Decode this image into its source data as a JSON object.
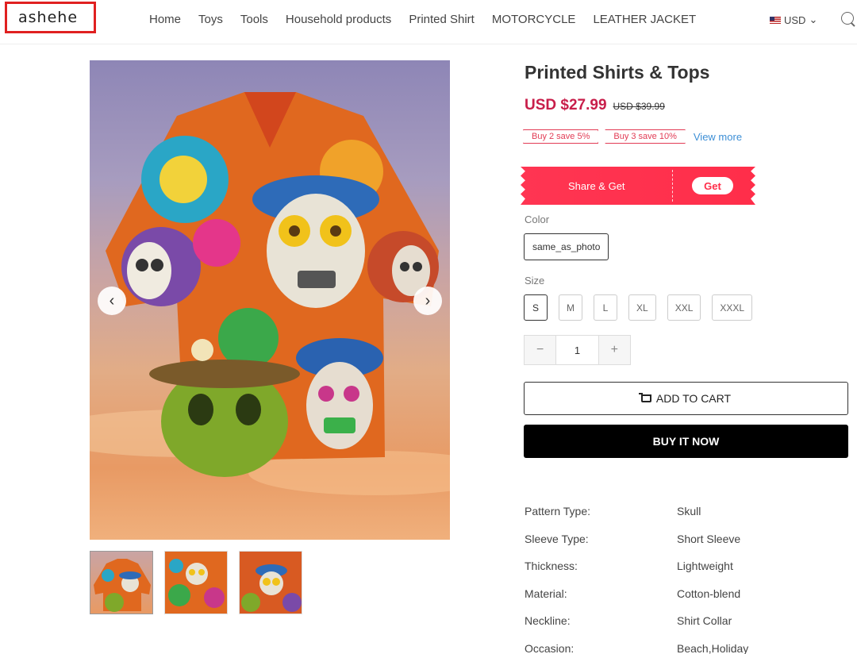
{
  "header": {
    "logo": "ashehe",
    "nav": [
      "Home",
      "Toys",
      "Tools",
      "Household products",
      "Printed Shirt",
      "MOTORCYCLE",
      "LEATHER JACKET"
    ],
    "currency": "USD"
  },
  "product": {
    "title": "Printed Shirts & Tops",
    "price_now": "USD $27.99",
    "price_was": "USD $39.99",
    "promos": [
      "Buy 2 save 5%",
      "Buy 3 save 10%"
    ],
    "view_more": "View more",
    "share_label": "Share & Get",
    "share_button": "Get",
    "color_label": "Color",
    "color_value": "same_as_photo",
    "size_label": "Size",
    "sizes": [
      "S",
      "M",
      "L",
      "XL",
      "XXL",
      "XXXL"
    ],
    "selected_size": "S",
    "quantity": "1",
    "qty_minus": "−",
    "qty_plus": "+",
    "add_to_cart": "ADD TO CART",
    "buy_now": "BUY IT NOW",
    "specs": [
      {
        "k": "Pattern Type:",
        "v": "Skull"
      },
      {
        "k": "Sleeve Type:",
        "v": "Short Sleeve"
      },
      {
        "k": "Thickness:",
        "v": "Lightweight"
      },
      {
        "k": "Material:",
        "v": "Cotton-blend"
      },
      {
        "k": "Neckline:",
        "v": "Shirt Collar"
      },
      {
        "k": "Occasion:",
        "v": "Beach,Holiday"
      }
    ]
  },
  "gallery": {
    "prev_arrow": "‹",
    "next_arrow": "›",
    "thumbnail_count": 3
  },
  "colors": {
    "accent_price": "#c81e4a",
    "promo": "#e23c55",
    "share_bg": "#ff2e4a",
    "link": "#3d8fd6",
    "logo_border": "#e02020"
  }
}
